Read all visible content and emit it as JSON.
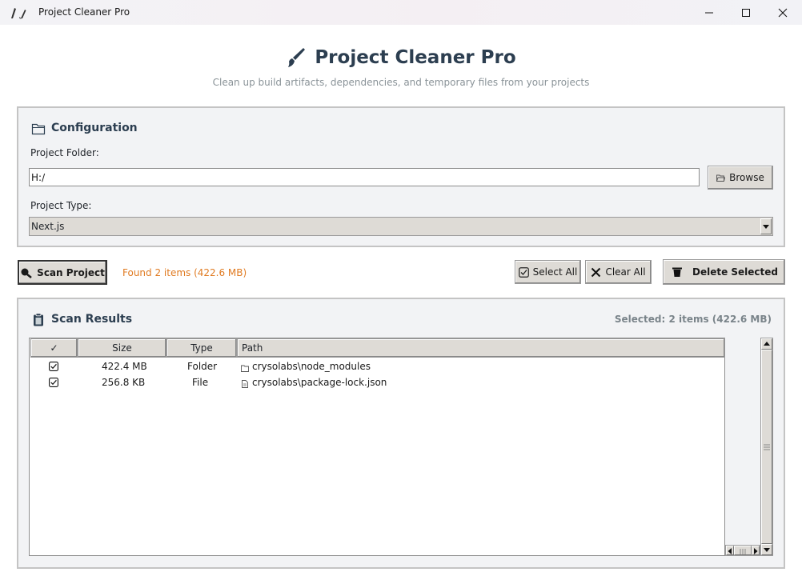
{
  "window": {
    "title": "Project Cleaner Pro",
    "app_icon": "feather-brush-icon",
    "controls": [
      "minimize-icon",
      "maximize-icon",
      "close-icon"
    ]
  },
  "header": {
    "title": "Project Cleaner Pro",
    "icon": "paintbrush-icon",
    "subtitle": "Clean up build artifacts, dependencies, and temporary files from your projects"
  },
  "configuration": {
    "title": "Configuration",
    "icon": "folder-icon",
    "folder_label": "Project Folder:",
    "folder_value": "H:/",
    "browse_label": "Browse",
    "type_label": "Project Type:",
    "type_value": "Next.js"
  },
  "actions": {
    "scan_label": "Scan Project",
    "status": "Found 2 items (422.6 MB)",
    "select_all_label": "Select All",
    "clear_all_label": "Clear All",
    "delete_label": "Delete Selected"
  },
  "results": {
    "title": "Scan Results",
    "icon": "clipboard-icon",
    "selected_info": "Selected: 2 items (422.6 MB)",
    "columns": {
      "check": "✓",
      "size": "Size",
      "type": "Type",
      "path": "Path"
    },
    "rows": [
      {
        "checked": true,
        "size": "422.4 MB",
        "type": "Folder",
        "path": "crysolabs\\node_modules",
        "icon": "folder-icon"
      },
      {
        "checked": true,
        "size": "256.8 KB",
        "type": "File",
        "path": "crysolabs\\package-lock.json",
        "icon": "file-icon"
      }
    ]
  },
  "colors": {
    "heading": "#2c3e50",
    "status_orange": "#e07b22",
    "muted": "#7a848a",
    "button_face": "#dedbd6",
    "frame_bg": "#f2f3f5"
  }
}
